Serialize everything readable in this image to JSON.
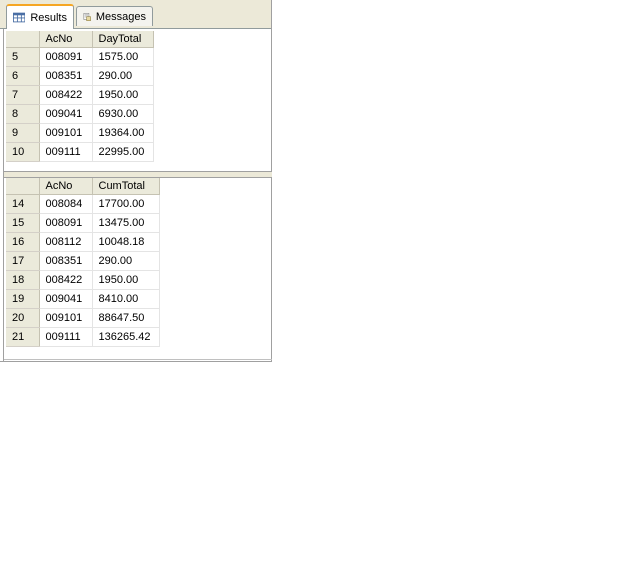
{
  "tabs": {
    "results": {
      "label": "Results",
      "icon": "grid-icon"
    },
    "messages": {
      "label": "Messages",
      "icon": "message-icon"
    }
  },
  "grid1": {
    "columns": [
      "AcNo",
      "DayTotal"
    ],
    "rows": [
      {
        "n": "5",
        "acno": "008091",
        "val": "1575.00"
      },
      {
        "n": "6",
        "acno": "008351",
        "val": "290.00"
      },
      {
        "n": "7",
        "acno": "008422",
        "val": "1950.00"
      },
      {
        "n": "8",
        "acno": "009041",
        "val": "6930.00"
      },
      {
        "n": "9",
        "acno": "009101",
        "val": "19364.00"
      },
      {
        "n": "10",
        "acno": "009111",
        "val": "22995.00"
      }
    ]
  },
  "grid2": {
    "columns": [
      "AcNo",
      "CumTotal"
    ],
    "rows": [
      {
        "n": "14",
        "acno": "008084",
        "val": "17700.00"
      },
      {
        "n": "15",
        "acno": "008091",
        "val": "13475.00"
      },
      {
        "n": "16",
        "acno": "008112",
        "val": "10048.18"
      },
      {
        "n": "17",
        "acno": "008351",
        "val": "290.00"
      },
      {
        "n": "18",
        "acno": "008422",
        "val": "1950.00"
      },
      {
        "n": "19",
        "acno": "009041",
        "val": "8410.00"
      },
      {
        "n": "20",
        "acno": "009101",
        "val": "88647.50"
      },
      {
        "n": "21",
        "acno": "009111",
        "val": "136265.42"
      }
    ]
  },
  "colors": {
    "accent_tab": "#f5a623",
    "header_bg": "#ebeadb",
    "tabstrip_bg": "#ece9d8"
  }
}
